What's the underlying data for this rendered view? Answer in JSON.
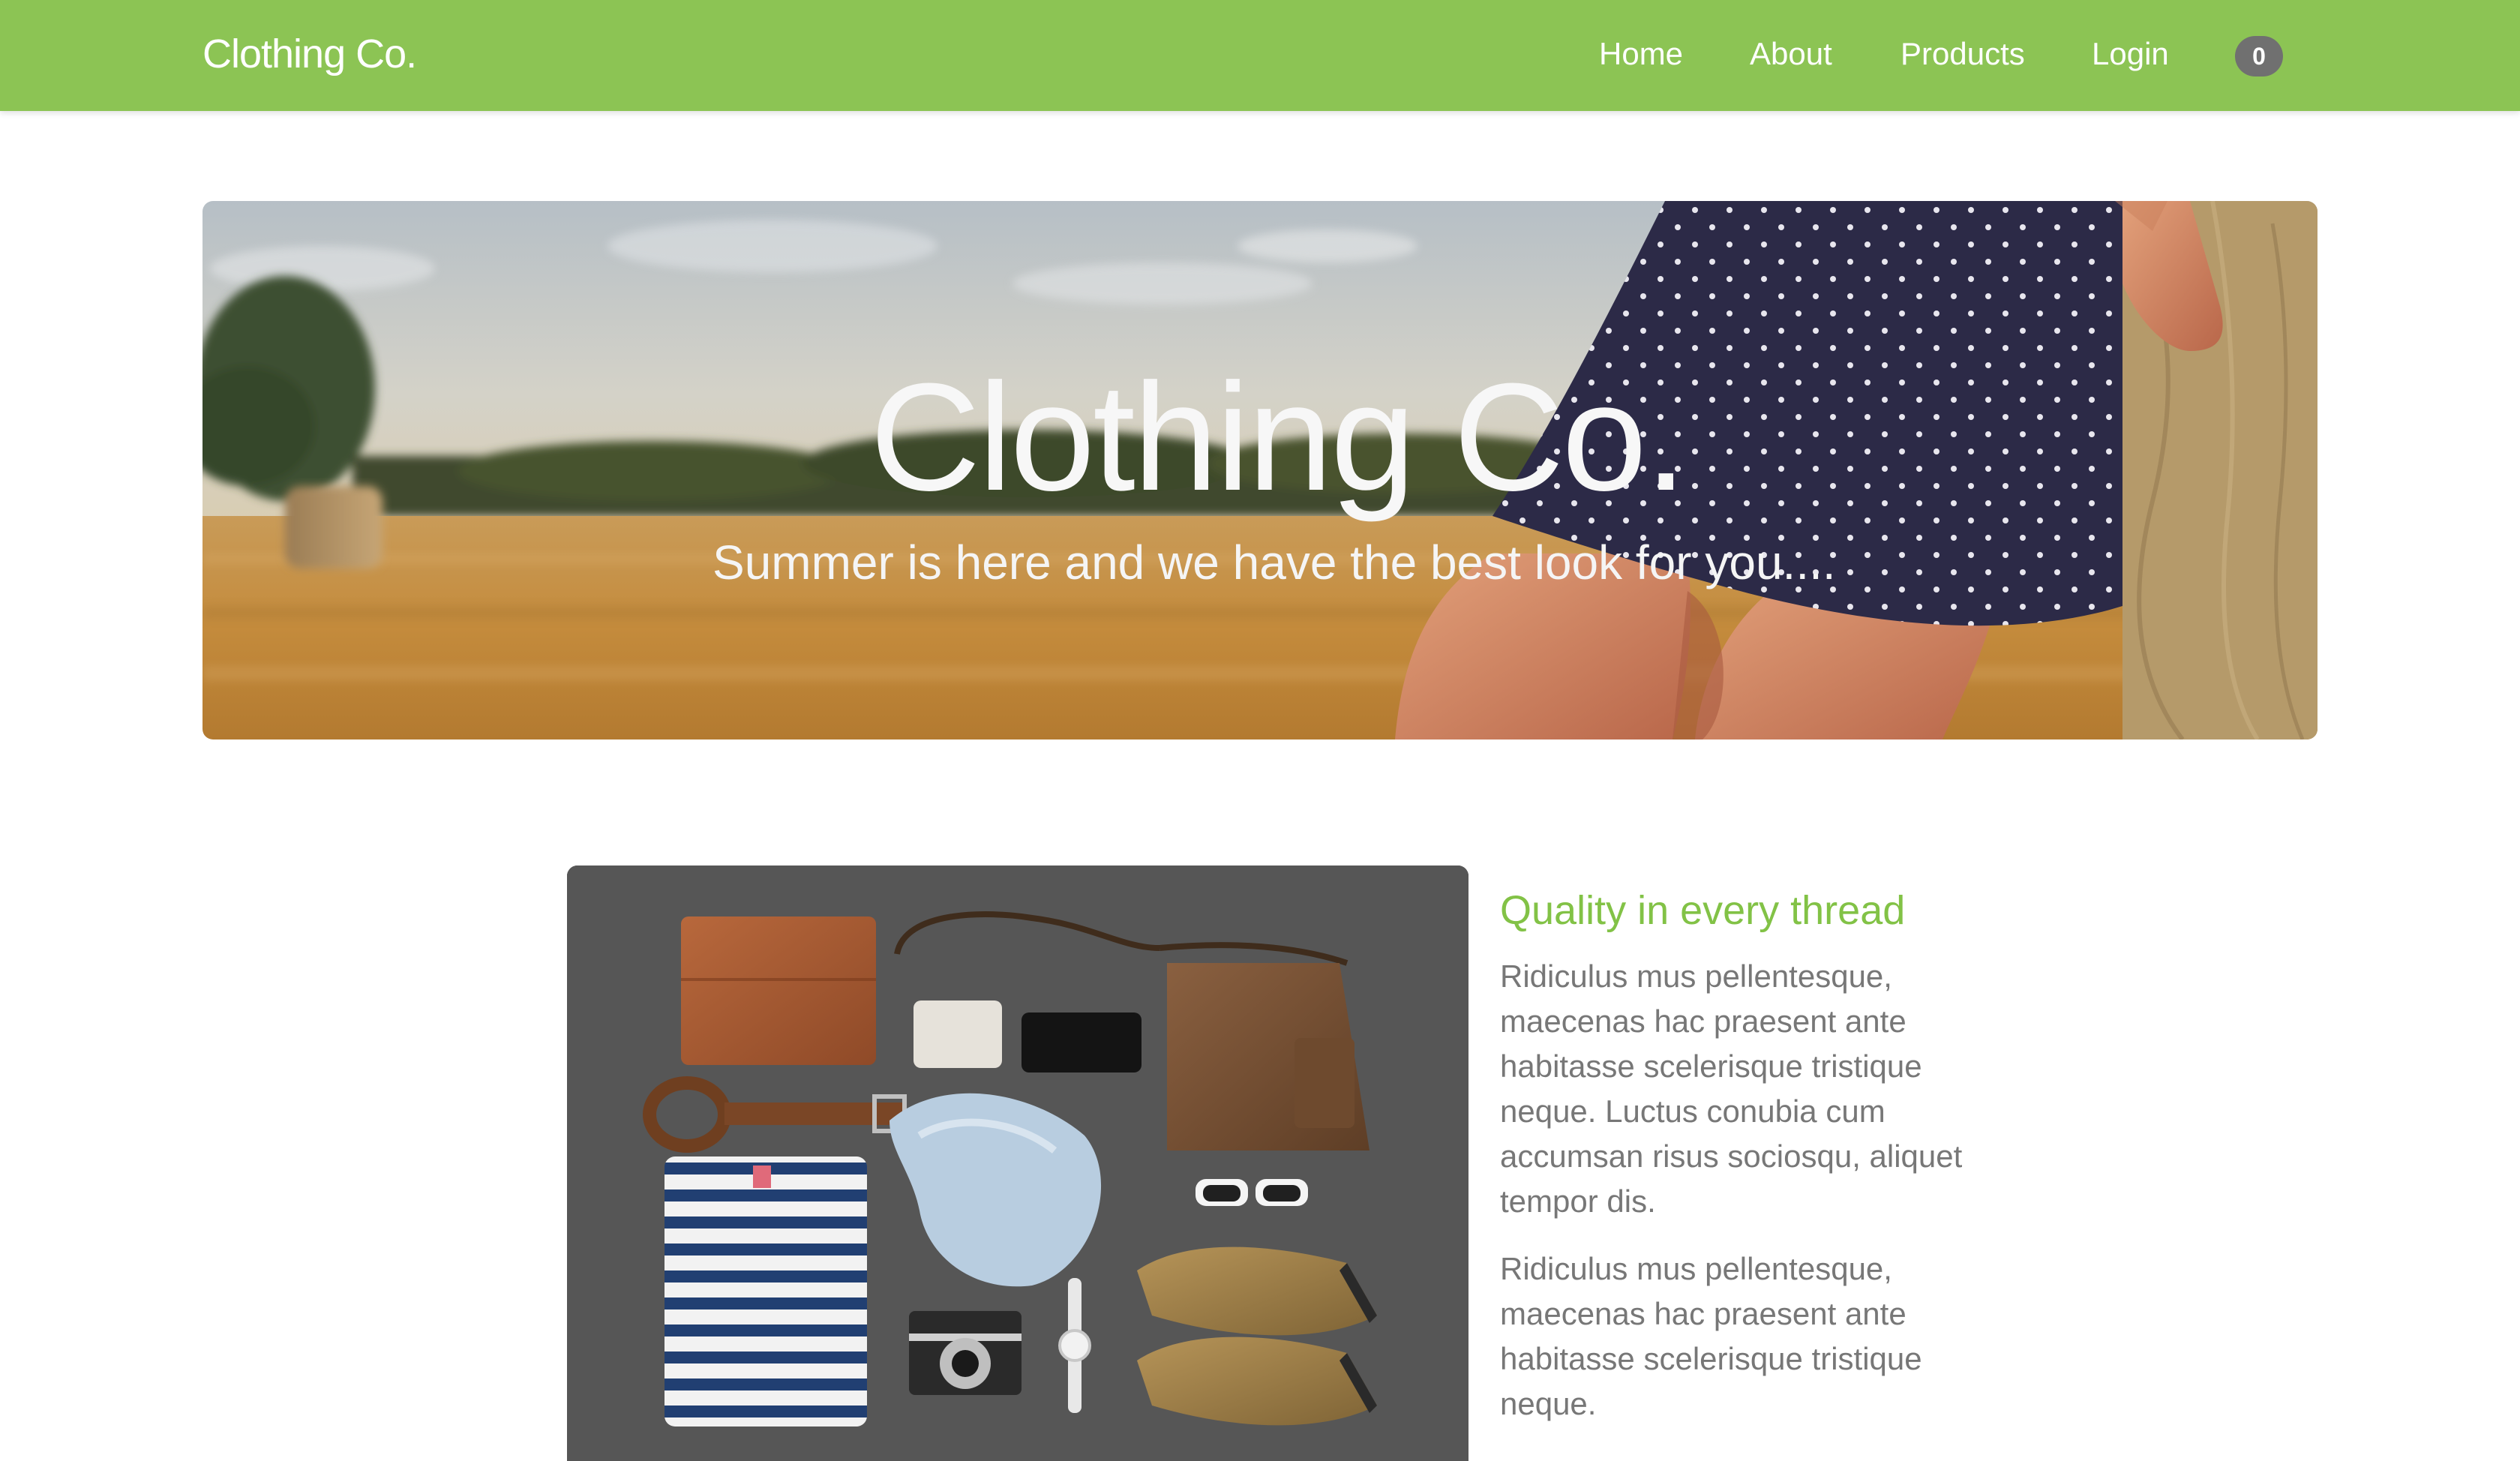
{
  "navbar": {
    "brand": "Clothing Co.",
    "links": [
      "Home",
      "About",
      "Products",
      "Login"
    ],
    "cart_count": "0",
    "background_color": "#8cc454"
  },
  "hero": {
    "title": "Clothing Co.",
    "subtitle": "Summer is here and we have the best look for you...."
  },
  "feature": {
    "heading": "Quality in every thread",
    "heading_color": "#82c246",
    "paragraphs": [
      "Ridiculus mus pellentesque, maecenas hac praesent ante habitasse scelerisque tristique neque. Luctus conubia cum accumsan risus sociosqu, aliquet tempor dis.",
      "Ridiculus mus pellentesque, maecenas hac praesent ante habitasse scelerisque tristique neque."
    ]
  }
}
